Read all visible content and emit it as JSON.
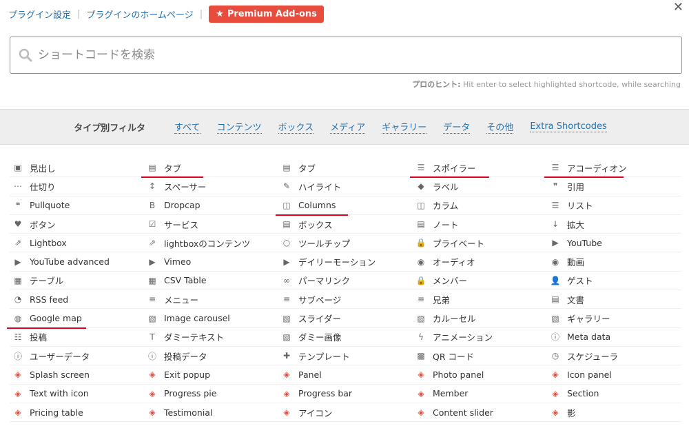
{
  "top": {
    "plugin_settings": "プラグイン設定",
    "plugin_homepage": "プラグインのホームページ",
    "premium_label": "Premium Add-ons",
    "separator": "|"
  },
  "search": {
    "placeholder": "ショートコードを検索",
    "value": ""
  },
  "hint": {
    "label": "プロのヒント:",
    "text": " Hit enter to select highlighted shortcode, while searching"
  },
  "filter": {
    "label": "タイプ別フィルタ",
    "options": [
      "すべて",
      "コンテンツ",
      "ボックス",
      "メディア",
      "ギャラリー",
      "データ",
      "その他",
      "Extra Shortcodes"
    ]
  },
  "items": [
    {
      "label": "見出し",
      "icon": "heading-icon",
      "glyph": "▣"
    },
    {
      "label": "タブ",
      "icon": "tabs-icon",
      "glyph": "▤",
      "underline": true
    },
    {
      "label": "タブ",
      "icon": "tab-icon",
      "glyph": "▤"
    },
    {
      "label": "スポイラー",
      "icon": "spoiler-icon",
      "glyph": "☰",
      "underline": true
    },
    {
      "label": "アコーディオン",
      "icon": "accordion-icon",
      "glyph": "☰",
      "underline": true
    },
    {
      "label": "仕切り",
      "icon": "divider-icon",
      "glyph": "⋯"
    },
    {
      "label": "スペーサー",
      "icon": "spacer-icon",
      "glyph": "↕"
    },
    {
      "label": "ハイライト",
      "icon": "pencil-icon",
      "glyph": "✎"
    },
    {
      "label": "ラベル",
      "icon": "tag-icon",
      "glyph": "◆"
    },
    {
      "label": "引用",
      "icon": "quote-icon",
      "glyph": "❞"
    },
    {
      "label": "Pullquote",
      "icon": "pullquote-icon",
      "glyph": "❝"
    },
    {
      "label": "Dropcap",
      "icon": "bold-icon",
      "glyph": "B"
    },
    {
      "label": "Columns",
      "icon": "columns-icon",
      "glyph": "◫",
      "underline": true
    },
    {
      "label": "カラム",
      "icon": "column-icon",
      "glyph": "◫"
    },
    {
      "label": "リスト",
      "icon": "list-icon",
      "glyph": "☰"
    },
    {
      "label": "ボタン",
      "icon": "heart-icon",
      "glyph": "♥"
    },
    {
      "label": "サービス",
      "icon": "check-square-icon",
      "glyph": "☑"
    },
    {
      "label": "ボックス",
      "icon": "box-icon",
      "glyph": "▤"
    },
    {
      "label": "ノート",
      "icon": "note-icon",
      "glyph": "▤"
    },
    {
      "label": "拡大",
      "icon": "sort-icon",
      "glyph": "↓"
    },
    {
      "label": "Lightbox",
      "icon": "external-link-icon",
      "glyph": "⇗"
    },
    {
      "label": "lightboxのコンテンツ",
      "icon": "external-link-icon",
      "glyph": "⇗"
    },
    {
      "label": "ツールチップ",
      "icon": "comment-icon",
      "glyph": "○"
    },
    {
      "label": "プライベート",
      "icon": "lock-icon",
      "glyph": "🔒"
    },
    {
      "label": "YouTube",
      "icon": "youtube-icon",
      "glyph": "▶"
    },
    {
      "label": "YouTube advanced",
      "icon": "youtube-icon",
      "glyph": "▶"
    },
    {
      "label": "Vimeo",
      "icon": "youtube-icon",
      "glyph": "▶"
    },
    {
      "label": "デイリーモーション",
      "icon": "youtube-icon",
      "glyph": "▶"
    },
    {
      "label": "オーディオ",
      "icon": "play-circle-icon",
      "glyph": "◉"
    },
    {
      "label": "動画",
      "icon": "play-circle-icon",
      "glyph": "◉"
    },
    {
      "label": "テーブル",
      "icon": "table-icon",
      "glyph": "▦"
    },
    {
      "label": "CSV Table",
      "icon": "table-icon",
      "glyph": "▦"
    },
    {
      "label": "パーマリンク",
      "icon": "link-icon",
      "glyph": "∞"
    },
    {
      "label": "メンバー",
      "icon": "lock-icon",
      "glyph": "🔒"
    },
    {
      "label": "ゲスト",
      "icon": "user-icon",
      "glyph": "👤"
    },
    {
      "label": "RSS feed",
      "icon": "rss-icon",
      "glyph": "◔"
    },
    {
      "label": "メニュー",
      "icon": "bars-icon",
      "glyph": "≡"
    },
    {
      "label": "サブページ",
      "icon": "bars-icon",
      "glyph": "≡"
    },
    {
      "label": "兄弟",
      "icon": "bars-icon",
      "glyph": "≡"
    },
    {
      "label": "文書",
      "icon": "file-icon",
      "glyph": "▤"
    },
    {
      "label": "Google map",
      "icon": "globe-icon",
      "glyph": "◍",
      "underline": true
    },
    {
      "label": "Image carousel",
      "icon": "picture-icon",
      "glyph": "▧"
    },
    {
      "label": "スライダー",
      "icon": "picture-icon",
      "glyph": "▧"
    },
    {
      "label": "カルーセル",
      "icon": "picture-icon",
      "glyph": "▧"
    },
    {
      "label": "ギャラリー",
      "icon": "picture-icon",
      "glyph": "▧"
    },
    {
      "label": "投稿",
      "icon": "th-list-icon",
      "glyph": "☷"
    },
    {
      "label": "ダミーテキスト",
      "icon": "text-height-icon",
      "glyph": "T"
    },
    {
      "label": "ダミー画像",
      "icon": "picture-icon",
      "glyph": "▧"
    },
    {
      "label": "アニメーション",
      "icon": "bolt-icon",
      "glyph": "ϟ"
    },
    {
      "label": "Meta data",
      "icon": "info-icon",
      "glyph": "ⓘ"
    },
    {
      "label": "ユーザーデータ",
      "icon": "info-icon",
      "glyph": "ⓘ"
    },
    {
      "label": "投稿データ",
      "icon": "info-icon",
      "glyph": "ⓘ"
    },
    {
      "label": "テンプレート",
      "icon": "puzzle-icon",
      "glyph": "✚"
    },
    {
      "label": "QR コード",
      "icon": "qrcode-icon",
      "glyph": "▩"
    },
    {
      "label": "スケジューラ",
      "icon": "clock-icon",
      "glyph": "◷"
    },
    {
      "label": "Splash screen",
      "icon": "layers-icon",
      "glyph": "◈",
      "red": true
    },
    {
      "label": "Exit popup",
      "icon": "layers-icon",
      "glyph": "◈",
      "red": true
    },
    {
      "label": "Panel",
      "icon": "layers-icon",
      "glyph": "◈",
      "red": true
    },
    {
      "label": "Photo panel",
      "icon": "layers-icon",
      "glyph": "◈",
      "red": true
    },
    {
      "label": "Icon panel",
      "icon": "layers-icon",
      "glyph": "◈",
      "red": true
    },
    {
      "label": "Text with icon",
      "icon": "layers-icon",
      "glyph": "◈",
      "red": true
    },
    {
      "label": "Progress pie",
      "icon": "layers-icon",
      "glyph": "◈",
      "red": true
    },
    {
      "label": "Progress bar",
      "icon": "layers-icon",
      "glyph": "◈",
      "red": true
    },
    {
      "label": "Member",
      "icon": "layers-icon",
      "glyph": "◈",
      "red": true
    },
    {
      "label": "Section",
      "icon": "layers-icon",
      "glyph": "◈",
      "red": true
    },
    {
      "label": "Pricing table",
      "icon": "layers-icon",
      "glyph": "◈",
      "red": true
    },
    {
      "label": "Testimonial",
      "icon": "layers-icon",
      "glyph": "◈",
      "red": true
    },
    {
      "label": "アイコン",
      "icon": "layers-icon",
      "glyph": "◈",
      "red": true
    },
    {
      "label": "Content slider",
      "icon": "layers-icon",
      "glyph": "◈",
      "red": true
    },
    {
      "label": "影",
      "icon": "layers-icon",
      "glyph": "◈",
      "red": true
    }
  ],
  "colors": {
    "accent": "#2271b1",
    "premium": "#e74c3c",
    "underline": "#e0001a"
  }
}
